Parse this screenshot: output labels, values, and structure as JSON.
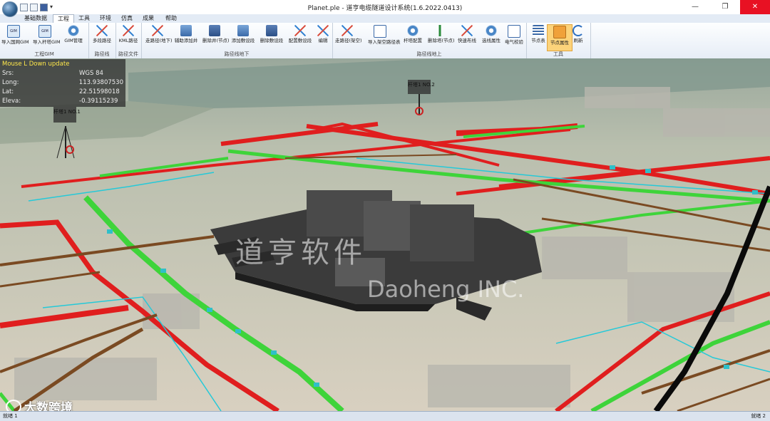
{
  "window": {
    "title": "Planet.ple - 道亨电缆隧道设计系统(1.6.2022.0413)",
    "buttons": [
      "—",
      "❐",
      "✕"
    ]
  },
  "tabs": [
    "基础数据",
    "工程",
    "工具",
    "环境",
    "仿真",
    "成果",
    "帮助"
  ],
  "active_tab": "工程",
  "ribbon": {
    "groups": [
      {
        "label": "工程GIM",
        "buttons": [
          "导入国网GIM",
          "导入杆塔GIM",
          "GIM管理"
        ]
      },
      {
        "label": "路径线",
        "buttons": [
          "多段路径"
        ]
      },
      {
        "label": "路径文件",
        "buttons": [
          "KML路径"
        ]
      },
      {
        "label": "路径线地下",
        "buttons": [
          "走路径(地下)",
          "辅助添加井",
          "删除井(节点)",
          "添加敷设段",
          "删除敷设段",
          "配置敷设段",
          "编辑"
        ]
      },
      {
        "label": "路径线地上",
        "buttons": [
          "走路径(架空)",
          "导入架空路径表",
          "杆塔配置",
          "删除塔(节点)",
          "快速布线",
          "选线属性",
          "电气校验"
        ]
      },
      {
        "label": "工具",
        "buttons": [
          "节点表",
          "节点属性",
          "刷新"
        ]
      }
    ],
    "selected_button": "节点属性"
  },
  "info_panel": {
    "header": "Mouse L Down update",
    "rows": [
      {
        "key": "Srs:",
        "value": "WGS 84"
      },
      {
        "key": "Long:",
        "value": "113.93807530"
      },
      {
        "key": "Lat:",
        "value": "22.51598018"
      },
      {
        "key": "Eleva:",
        "value": "-0.39115239"
      }
    ]
  },
  "towers": [
    {
      "label": "杆塔1",
      "sub": "NO.1"
    },
    {
      "label": "杆塔1",
      "sub": "NO.2"
    }
  ],
  "scene_watermark": {
    "chinese": "道亨软件",
    "english": "Daoheng INC."
  },
  "status": {
    "left": "就绪 1",
    "right": "就绪 2"
  },
  "corner_watermark": "大数跨境",
  "colors": {
    "power_red": "#e01e1e",
    "pipe_green": "#3ed43a",
    "cable_brown": "#7a4a22",
    "cable_cyan": "#25c9d8",
    "ribbon_selected": "#fcd37a",
    "close_button": "#e81123"
  }
}
